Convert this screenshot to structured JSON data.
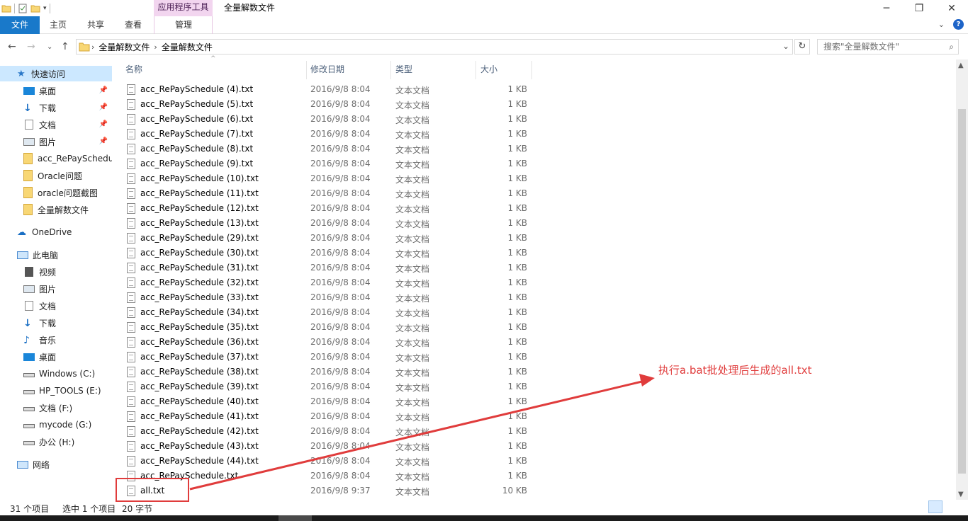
{
  "titlebar": {
    "context_tab": "应用程序工具",
    "window_title": "全量解数文件"
  },
  "ribbon": {
    "tabs": [
      "文件",
      "主页",
      "共享",
      "查看",
      "管理"
    ]
  },
  "address": {
    "crumbs": [
      "全量解数文件",
      "全量解数文件"
    ],
    "search_placeholder": "搜索\"全量解数文件\""
  },
  "sidebar": {
    "items": [
      {
        "label": "快速访问",
        "icon": "star-icon"
      },
      {
        "label": "桌面",
        "icon": "desktop-icon"
      },
      {
        "label": "下载",
        "icon": "download-icon"
      },
      {
        "label": "文档",
        "icon": "document-icon"
      },
      {
        "label": "图片",
        "icon": "picture-icon"
      },
      {
        "label": "acc_RePaySchedul",
        "icon": "folder-icon"
      },
      {
        "label": "Oracle问题",
        "icon": "folder-icon"
      },
      {
        "label": "oracle问题截图",
        "icon": "folder-icon"
      },
      {
        "label": "全量解数文件",
        "icon": "folder-icon"
      },
      {
        "label": "OneDrive",
        "icon": "cloud-icon"
      },
      {
        "label": "此电脑",
        "icon": "computer-icon"
      },
      {
        "label": "视频",
        "icon": "video-icon"
      },
      {
        "label": "图片",
        "icon": "picture-icon"
      },
      {
        "label": "文档",
        "icon": "document-icon"
      },
      {
        "label": "下载",
        "icon": "download-icon"
      },
      {
        "label": "音乐",
        "icon": "music-icon"
      },
      {
        "label": "桌面",
        "icon": "desktop-icon"
      },
      {
        "label": "Windows (C:)",
        "icon": "drive-icon"
      },
      {
        "label": "HP_TOOLS (E:)",
        "icon": "drive-icon"
      },
      {
        "label": "文档 (F:)",
        "icon": "drive-icon"
      },
      {
        "label": "mycode (G:)",
        "icon": "drive-icon"
      },
      {
        "label": "办公 (H:)",
        "icon": "drive-icon"
      },
      {
        "label": "网络",
        "icon": "network-icon"
      }
    ]
  },
  "columns": {
    "name": "名称",
    "date": "修改日期",
    "type": "类型",
    "size": "大小"
  },
  "files": [
    {
      "name": "acc_RePaySchedule (4).txt",
      "date": "2016/9/8 8:04",
      "type": "文本文档",
      "size": "1 KB"
    },
    {
      "name": "acc_RePaySchedule (5).txt",
      "date": "2016/9/8 8:04",
      "type": "文本文档",
      "size": "1 KB"
    },
    {
      "name": "acc_RePaySchedule (6).txt",
      "date": "2016/9/8 8:04",
      "type": "文本文档",
      "size": "1 KB"
    },
    {
      "name": "acc_RePaySchedule (7).txt",
      "date": "2016/9/8 8:04",
      "type": "文本文档",
      "size": "1 KB"
    },
    {
      "name": "acc_RePaySchedule (8).txt",
      "date": "2016/9/8 8:04",
      "type": "文本文档",
      "size": "1 KB"
    },
    {
      "name": "acc_RePaySchedule (9).txt",
      "date": "2016/9/8 8:04",
      "type": "文本文档",
      "size": "1 KB"
    },
    {
      "name": "acc_RePaySchedule (10).txt",
      "date": "2016/9/8 8:04",
      "type": "文本文档",
      "size": "1 KB"
    },
    {
      "name": "acc_RePaySchedule (11).txt",
      "date": "2016/9/8 8:04",
      "type": "文本文档",
      "size": "1 KB"
    },
    {
      "name": "acc_RePaySchedule (12).txt",
      "date": "2016/9/8 8:04",
      "type": "文本文档",
      "size": "1 KB"
    },
    {
      "name": "acc_RePaySchedule (13).txt",
      "date": "2016/9/8 8:04",
      "type": "文本文档",
      "size": "1 KB"
    },
    {
      "name": "acc_RePaySchedule (29).txt",
      "date": "2016/9/8 8:04",
      "type": "文本文档",
      "size": "1 KB"
    },
    {
      "name": "acc_RePaySchedule (30).txt",
      "date": "2016/9/8 8:04",
      "type": "文本文档",
      "size": "1 KB"
    },
    {
      "name": "acc_RePaySchedule (31).txt",
      "date": "2016/9/8 8:04",
      "type": "文本文档",
      "size": "1 KB"
    },
    {
      "name": "acc_RePaySchedule (32).txt",
      "date": "2016/9/8 8:04",
      "type": "文本文档",
      "size": "1 KB"
    },
    {
      "name": "acc_RePaySchedule (33).txt",
      "date": "2016/9/8 8:04",
      "type": "文本文档",
      "size": "1 KB"
    },
    {
      "name": "acc_RePaySchedule (34).txt",
      "date": "2016/9/8 8:04",
      "type": "文本文档",
      "size": "1 KB"
    },
    {
      "name": "acc_RePaySchedule (35).txt",
      "date": "2016/9/8 8:04",
      "type": "文本文档",
      "size": "1 KB"
    },
    {
      "name": "acc_RePaySchedule (36).txt",
      "date": "2016/9/8 8:04",
      "type": "文本文档",
      "size": "1 KB"
    },
    {
      "name": "acc_RePaySchedule (37).txt",
      "date": "2016/9/8 8:04",
      "type": "文本文档",
      "size": "1 KB"
    },
    {
      "name": "acc_RePaySchedule (38).txt",
      "date": "2016/9/8 8:04",
      "type": "文本文档",
      "size": "1 KB"
    },
    {
      "name": "acc_RePaySchedule (39).txt",
      "date": "2016/9/8 8:04",
      "type": "文本文档",
      "size": "1 KB"
    },
    {
      "name": "acc_RePaySchedule (40).txt",
      "date": "2016/9/8 8:04",
      "type": "文本文档",
      "size": "1 KB"
    },
    {
      "name": "acc_RePaySchedule (41).txt",
      "date": "2016/9/8 8:04",
      "type": "文本文档",
      "size": "1 KB"
    },
    {
      "name": "acc_RePaySchedule (42).txt",
      "date": "2016/9/8 8:04",
      "type": "文本文档",
      "size": "1 KB"
    },
    {
      "name": "acc_RePaySchedule (43).txt",
      "date": "2016/9/8 8:04",
      "type": "文本文档",
      "size": "1 KB"
    },
    {
      "name": "acc_RePaySchedule (44).txt",
      "date": "2016/9/8 8:04",
      "type": "文本文档",
      "size": "1 KB"
    },
    {
      "name": "acc_RePaySchedule.txt",
      "date": "2016/9/8 8:04",
      "type": "文本文档",
      "size": "1 KB"
    },
    {
      "name": "all.txt",
      "date": "2016/9/8 9:37",
      "type": "文本文档",
      "size": "10 KB"
    }
  ],
  "status": {
    "count": "31 个项目",
    "selected": "选中 1 个项目",
    "selected_size": "20 字节"
  },
  "annotation": {
    "text": "执行a.bat批处理后生成的all.txt",
    "color": "#e03c3c"
  },
  "colors": {
    "accent": "#1979ca",
    "context_tab": "#f2d5ef",
    "selection": "#cce8ff"
  }
}
